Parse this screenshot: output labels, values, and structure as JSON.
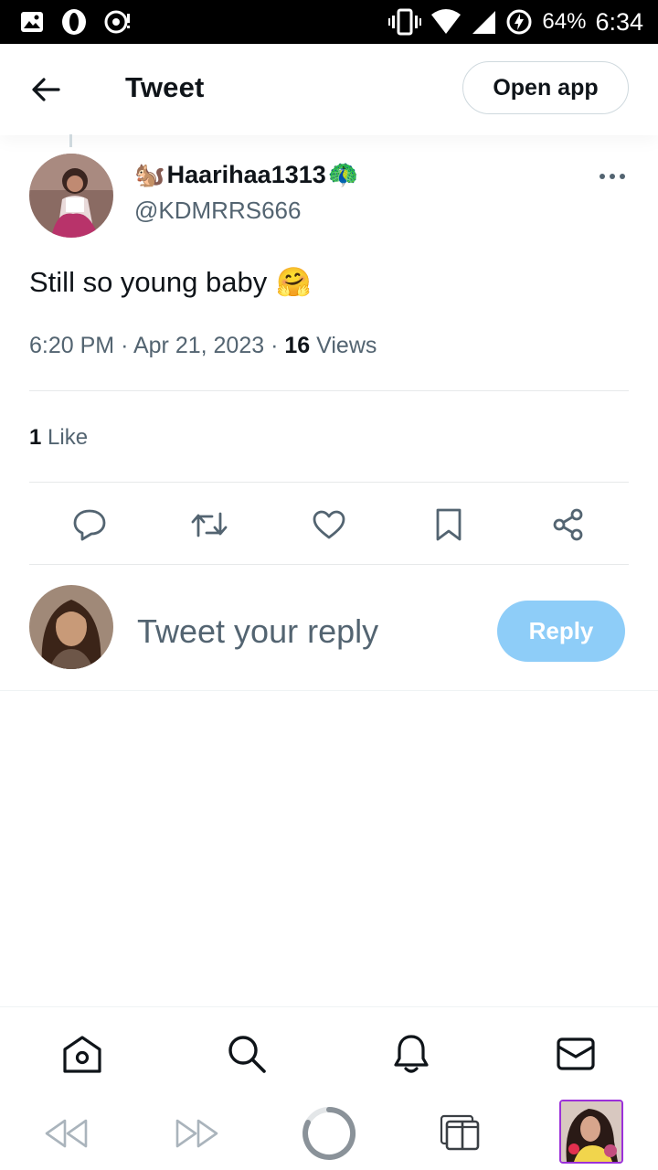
{
  "status_bar": {
    "battery_percent": "64%",
    "time": "6:34"
  },
  "header": {
    "title": "Tweet",
    "open_app_label": "Open app"
  },
  "tweet": {
    "author": {
      "display_name": "Haarihaa1313",
      "name_prefix_emoji": "🐿️",
      "name_suffix_emoji": "🦚",
      "handle": "@KDMRRS666"
    },
    "text": "Still so young baby",
    "text_emoji": "🤗",
    "time": "6:20 PM",
    "date": "Apr 21, 2023",
    "views_count": "16",
    "views_label": "Views",
    "likes_count": "1",
    "likes_label": "Like"
  },
  "reply": {
    "placeholder": "Tweet your reply",
    "button_label": "Reply"
  },
  "colors": {
    "accent": "#1d9bf0",
    "reply_button_disabled": "#8ecdf8",
    "secondary_text": "#536471",
    "divider": "#e7e9ea",
    "tab_thumb_border": "#9b30d9"
  },
  "icons": {
    "status_left": [
      "gallery-icon",
      "opera-icon",
      "download-icon"
    ],
    "status_right": [
      "vibrate-icon",
      "wifi-icon",
      "signal-icon",
      "battery-charging-icon"
    ],
    "actions": [
      "reply-icon",
      "retweet-icon",
      "like-icon",
      "bookmark-icon",
      "share-icon"
    ],
    "bottom_nav": [
      "home-icon",
      "search-icon",
      "notifications-icon",
      "messages-icon"
    ],
    "browser_bar": [
      "back-icon",
      "forward-icon",
      "loading-icon",
      "tabs-icon",
      "tab-thumbnail"
    ]
  }
}
